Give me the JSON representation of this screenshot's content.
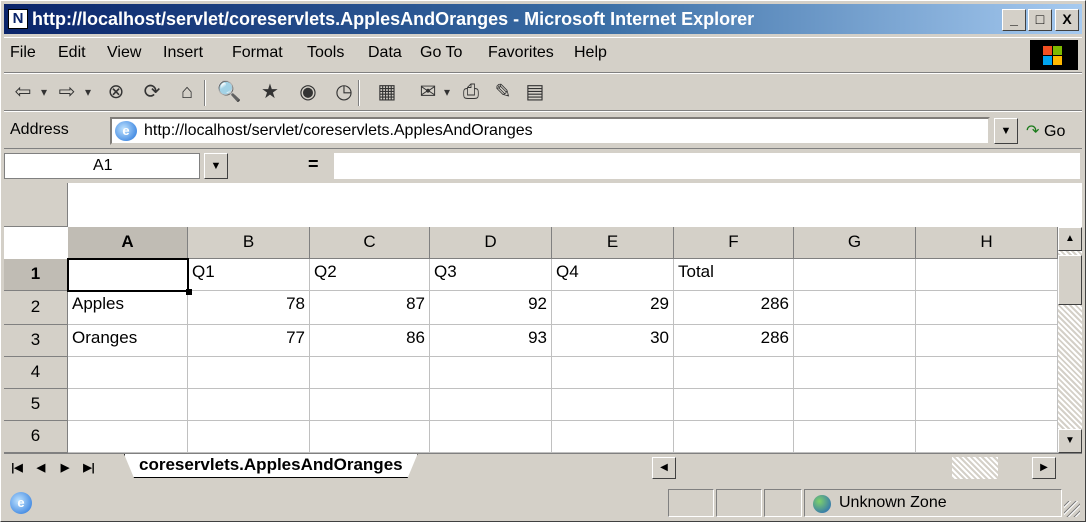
{
  "window": {
    "title": "http://localhost/servlet/coreservlets.ApplesAndOranges - Microsoft Internet Explorer",
    "app_logo": "N",
    "minimize_glyph": "_",
    "maximize_glyph": "□",
    "close_glyph": "X"
  },
  "menu": [
    "File",
    "Edit",
    "View",
    "Insert",
    "Format",
    "Tools",
    "Data",
    "Go To",
    "Favorites",
    "Help"
  ],
  "toolbar": {
    "buttons": [
      {
        "name": "back-icon",
        "glyph": "⇦"
      },
      {
        "name": "back-dropdown-icon",
        "glyph": "▾"
      },
      {
        "name": "forward-icon",
        "glyph": "⇨"
      },
      {
        "name": "forward-dropdown-icon",
        "glyph": "▾"
      },
      {
        "name": "stop-icon",
        "glyph": "⊗"
      },
      {
        "name": "refresh-icon",
        "glyph": "⟳"
      },
      {
        "name": "home-icon",
        "glyph": "⌂"
      },
      {
        "name": "search-icon",
        "glyph": "🔍"
      },
      {
        "name": "favorites-icon",
        "glyph": "★"
      },
      {
        "name": "media-icon",
        "glyph": "◉"
      },
      {
        "name": "history-icon",
        "glyph": "◷"
      },
      {
        "name": "channels-icon",
        "glyph": "▦"
      },
      {
        "name": "mail-icon",
        "glyph": "✉"
      },
      {
        "name": "mail-dropdown-icon",
        "glyph": "▾"
      },
      {
        "name": "print-icon",
        "glyph": "⎙"
      },
      {
        "name": "edit-icon",
        "glyph": "✎"
      },
      {
        "name": "discuss-icon",
        "glyph": "▤"
      }
    ]
  },
  "address": {
    "label": "Address",
    "url": "http://localhost/servlet/coreservlets.ApplesAndOranges",
    "dropdown_glyph": "▼",
    "go_glyph": "↷",
    "go_label": "Go"
  },
  "formula_bar": {
    "name_box": "A1",
    "dropdown_glyph": "▼",
    "equals": "=",
    "formula": ""
  },
  "sheet": {
    "columns": [
      "A",
      "B",
      "C",
      "D",
      "E",
      "F",
      "G",
      "H"
    ],
    "rows": [
      "1",
      "2",
      "3",
      "4",
      "5",
      "6"
    ],
    "selected_cell": "A1",
    "data": [
      [
        {
          "v": "",
          "num": false
        },
        {
          "v": "Q1",
          "num": false
        },
        {
          "v": "Q2",
          "num": false
        },
        {
          "v": "Q3",
          "num": false
        },
        {
          "v": "Q4",
          "num": false
        },
        {
          "v": "Total",
          "num": false
        },
        {
          "v": "",
          "num": false
        },
        {
          "v": "",
          "num": false
        }
      ],
      [
        {
          "v": "Apples",
          "num": false
        },
        {
          "v": "78",
          "num": true
        },
        {
          "v": "87",
          "num": true
        },
        {
          "v": "92",
          "num": true
        },
        {
          "v": "29",
          "num": true
        },
        {
          "v": "286",
          "num": true
        },
        {
          "v": "",
          "num": false
        },
        {
          "v": "",
          "num": false
        }
      ],
      [
        {
          "v": "Oranges",
          "num": false
        },
        {
          "v": "77",
          "num": true
        },
        {
          "v": "86",
          "num": true
        },
        {
          "v": "93",
          "num": true
        },
        {
          "v": "30",
          "num": true
        },
        {
          "v": "286",
          "num": true
        },
        {
          "v": "",
          "num": false
        },
        {
          "v": "",
          "num": false
        }
      ],
      [
        {
          "v": "",
          "num": false
        },
        {
          "v": "",
          "num": false
        },
        {
          "v": "",
          "num": false
        },
        {
          "v": "",
          "num": false
        },
        {
          "v": "",
          "num": false
        },
        {
          "v": "",
          "num": false
        },
        {
          "v": "",
          "num": false
        },
        {
          "v": "",
          "num": false
        }
      ],
      [
        {
          "v": "",
          "num": false
        },
        {
          "v": "",
          "num": false
        },
        {
          "v": "",
          "num": false
        },
        {
          "v": "",
          "num": false
        },
        {
          "v": "",
          "num": false
        },
        {
          "v": "",
          "num": false
        },
        {
          "v": "",
          "num": false
        },
        {
          "v": "",
          "num": false
        }
      ],
      [
        {
          "v": "",
          "num": false
        },
        {
          "v": "",
          "num": false
        },
        {
          "v": "",
          "num": false
        },
        {
          "v": "",
          "num": false
        },
        {
          "v": "",
          "num": false
        },
        {
          "v": "",
          "num": false
        },
        {
          "v": "",
          "num": false
        },
        {
          "v": "",
          "num": false
        }
      ]
    ],
    "scroll_up_glyph": "▲",
    "scroll_down_glyph": "▼"
  },
  "tabs": {
    "nav": [
      "|◀",
      "◀",
      "▶",
      "▶|"
    ],
    "sheet_name": "coreservlets.ApplesAndOranges",
    "hscroll_left_glyph": "◀",
    "hscroll_right_glyph": "▶"
  },
  "status": {
    "zone": "Unknown Zone"
  },
  "colors": {
    "title_gradient_start": "#0a246a",
    "chrome": "#d4d0c8",
    "header_selected": "#c0bcb4"
  }
}
